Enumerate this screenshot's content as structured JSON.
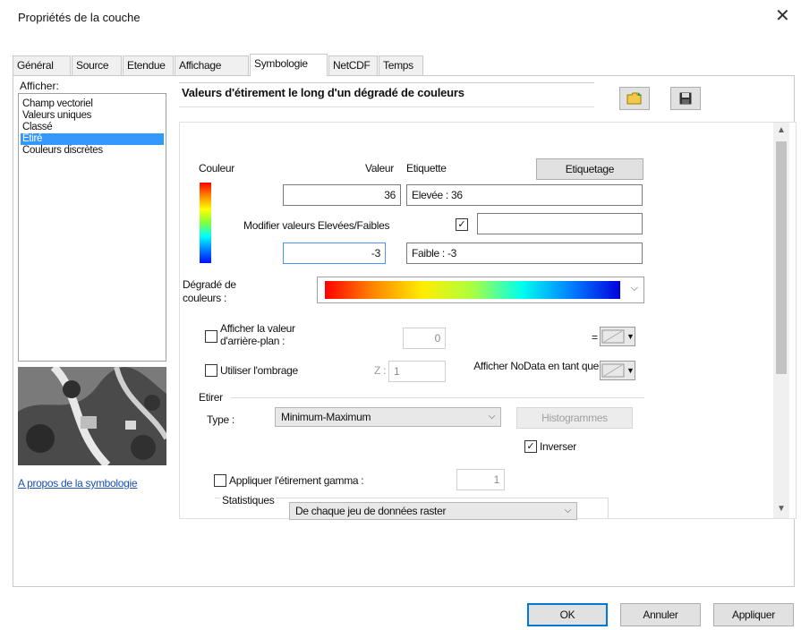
{
  "window": {
    "title": "Propriétés de la couche"
  },
  "tabs": [
    "Général",
    "Source",
    "Etendue",
    "Affichage",
    "Symbologie",
    "NetCDF",
    "Temps"
  ],
  "active_tab": "Symbologie",
  "left": {
    "show_label": "Afficher:",
    "items": [
      "Champ vectoriel",
      "Valeurs uniques",
      "Classé",
      "Etiré",
      "Couleurs discrètes"
    ],
    "selected": "Etiré",
    "about_link": "A propos de la symbologie"
  },
  "header": {
    "title": "Valeurs d'étirement le long d'un dégradé de couleurs"
  },
  "colors": {
    "couleur_label": "Couleur",
    "valeur_label": "Valeur",
    "etiquette_label": "Etiquette",
    "etiquetage_button": "Etiquetage",
    "high_value": "36",
    "high_label": "Elevée : 36",
    "modify_label": "Modifier valeurs Elevées/Faibles",
    "low_value": "-3",
    "low_label": "Faible : -3"
  },
  "ramp": {
    "label": "Dégradé de couleurs :"
  },
  "background": {
    "label": "Afficher la valeur d'arrière-plan :",
    "value": "0",
    "eq": "="
  },
  "hillshade": {
    "label": "Utiliser l'ombrage",
    "z_label": "Z :",
    "z_value": "1"
  },
  "nodata": {
    "label": "Afficher NoData en tant que"
  },
  "stretch": {
    "group_label": "Etirer",
    "type_label": "Type :",
    "type_value": "Minimum-Maximum",
    "histogram_button": "Histogrammes",
    "invert_label": "Inverser",
    "gamma_label": "Appliquer l'étirement gamma :",
    "gamma_value": "1",
    "stats_label": "Statistiques",
    "stats_value": "De chaque jeu de données raster"
  },
  "footer": {
    "ok": "OK",
    "cancel": "Annuler",
    "apply": "Appliquer"
  }
}
